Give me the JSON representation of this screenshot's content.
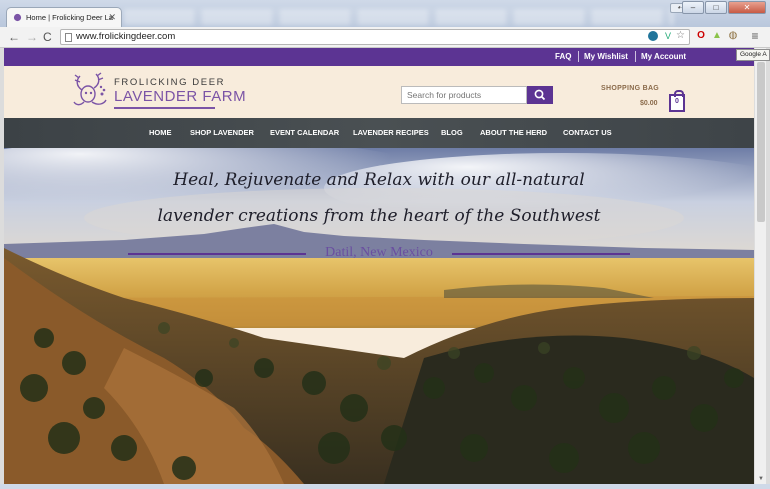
{
  "browser": {
    "tab_title": "Home | Frolicking Deer La",
    "tab_close": "✕",
    "url": "www.frolickingdeer.com",
    "tooltip": "Google A",
    "minimize": "–",
    "maximize": "□",
    "close": "✕"
  },
  "topbar": {
    "links": [
      "FAQ",
      "My Wishlist",
      "My Account"
    ]
  },
  "header": {
    "logo_top": "FROLICKING DEER",
    "logo_main": "LAVENDER FARM",
    "search_placeholder": "Search for products",
    "bag_label": "SHOPPING BAG",
    "bag_total": "$0.00",
    "bag_count": "0"
  },
  "nav": {
    "items": [
      "HOME",
      "SHOP LAVENDER",
      "EVENT CALENDAR",
      "LAVENDER RECIPES",
      "BLOG",
      "ABOUT THE HERD",
      "CONTACT US"
    ]
  },
  "hero": {
    "line1": "Heal, Rejuvenate and Relax with our all-natural",
    "line2": "lavender creations from the heart of the Southwest",
    "location": "Datil, New Mexico"
  },
  "colors": {
    "brand_purple": "#5c3493",
    "nav_bg": "#45494c",
    "header_bg": "#f8ecdc"
  }
}
